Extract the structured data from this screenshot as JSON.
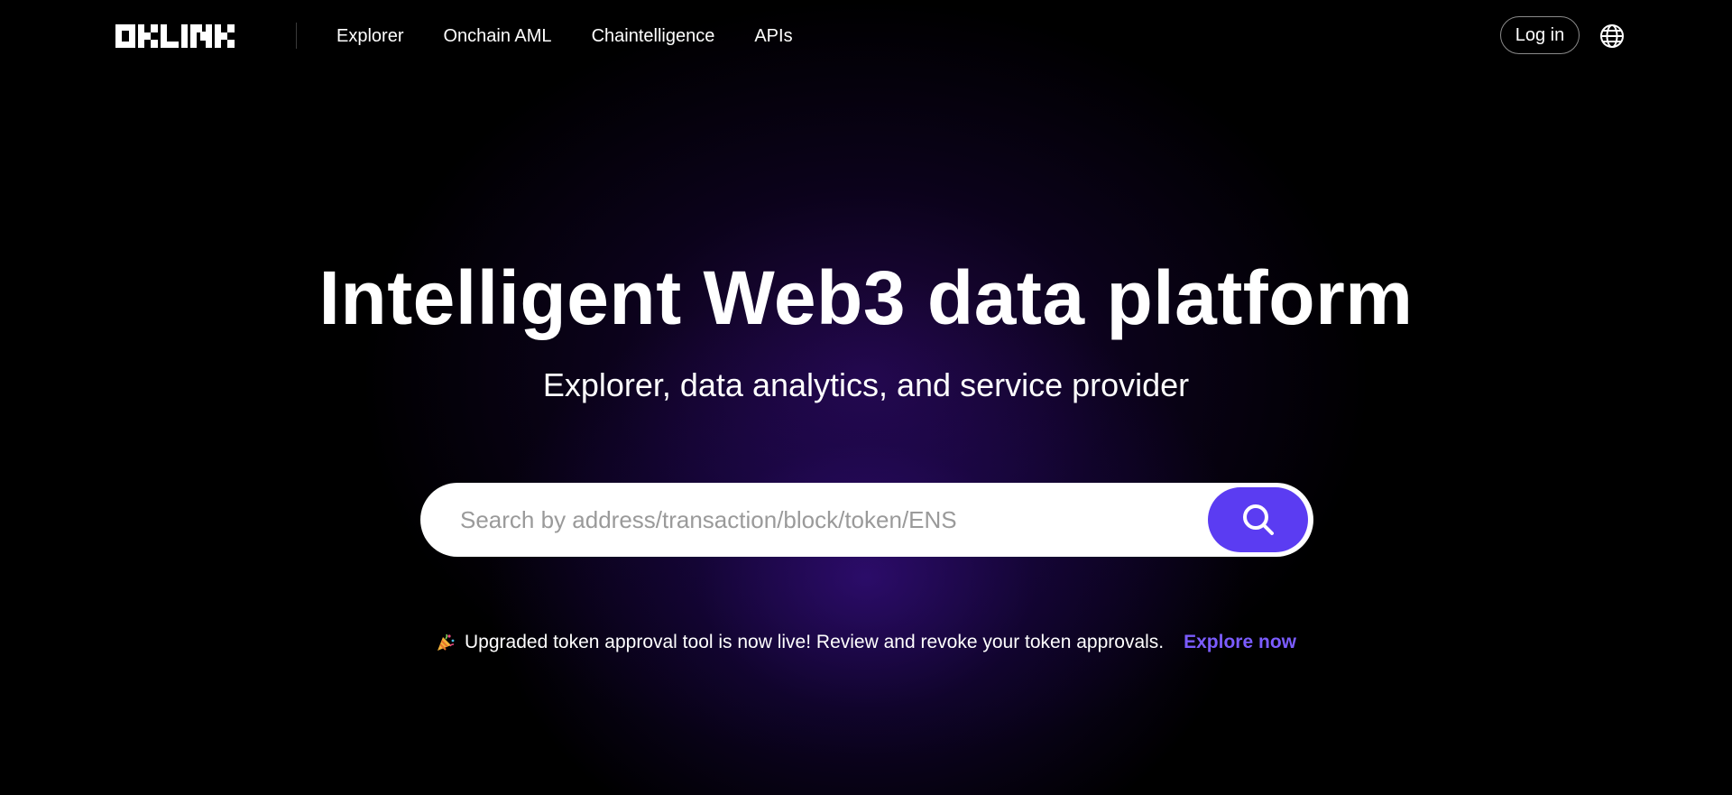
{
  "header": {
    "logo_text": "OKLINK",
    "nav": [
      {
        "label": "Explorer"
      },
      {
        "label": "Onchain AML"
      },
      {
        "label": "Chaintelligence"
      },
      {
        "label": "APIs"
      }
    ],
    "login_label": "Log in",
    "language_icon": "globe-icon"
  },
  "hero": {
    "title": "Intelligent Web3 data platform",
    "subtitle": "Explorer, data analytics, and service provider"
  },
  "search": {
    "placeholder": "Search by address/transaction/block/token/ENS",
    "value": "",
    "button_icon": "search-icon"
  },
  "announcement": {
    "icon": "party-popper-icon",
    "text": "Upgraded token approval tool is now live! Review and revoke your token approvals.",
    "link_label": "Explore now"
  },
  "colors": {
    "background": "#000000",
    "accent": "#5b3cf2",
    "link": "#7b5cff",
    "glow": "#3a0d8a"
  }
}
